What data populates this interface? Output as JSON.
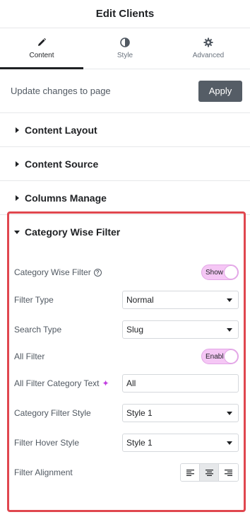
{
  "header": {
    "title": "Edit Clients"
  },
  "tabs": [
    {
      "label": "Content",
      "icon": "pencil-icon",
      "active": true
    },
    {
      "label": "Style",
      "icon": "contrast-icon",
      "active": false
    },
    {
      "label": "Advanced",
      "icon": "gear-icon",
      "active": false
    }
  ],
  "update": {
    "text": "Update changes to page",
    "apply_label": "Apply"
  },
  "sections": [
    {
      "label": "Content Layout"
    },
    {
      "label": "Content Source"
    },
    {
      "label": "Columns Manage"
    }
  ],
  "open_section": {
    "title": "Category Wise Filter",
    "controls": {
      "category_wise_filter": {
        "label": "Category Wise Filter",
        "value": "Show"
      },
      "filter_type": {
        "label": "Filter Type",
        "value": "Normal"
      },
      "search_type": {
        "label": "Search Type",
        "value": "Slug"
      },
      "all_filter": {
        "label": "All Filter",
        "value": "Enable"
      },
      "all_filter_text": {
        "label": "All Filter Category Text",
        "value": "All"
      },
      "category_filter_style": {
        "label": "Category Filter Style",
        "value": "Style 1"
      },
      "filter_hover_style": {
        "label": "Filter Hover Style",
        "value": "Style 1"
      },
      "filter_alignment": {
        "label": "Filter Alignment",
        "options": [
          "left",
          "center",
          "right"
        ],
        "selected": "center"
      }
    }
  },
  "colors": {
    "accent_border": "#e0474f",
    "toggle_bg": "#f5c7f5",
    "apply_bg": "#555d66"
  }
}
